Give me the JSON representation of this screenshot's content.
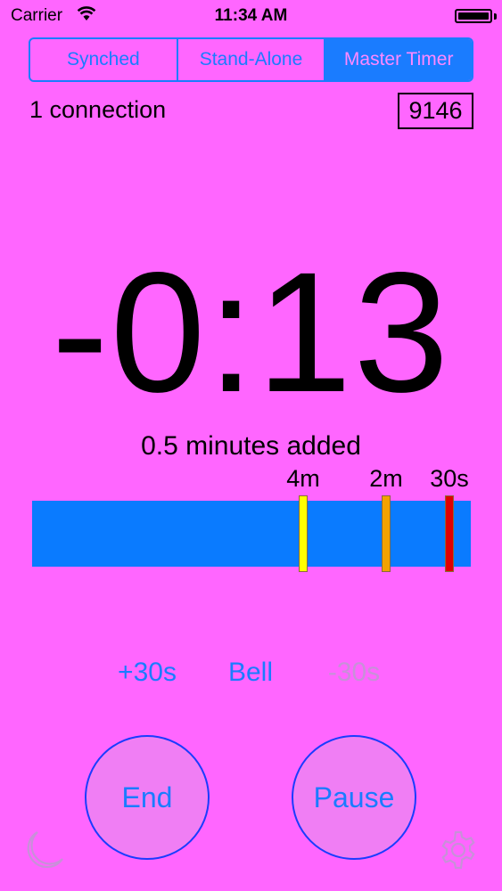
{
  "status_bar": {
    "carrier": "Carrier",
    "time": "11:34 AM"
  },
  "mode_control": {
    "segments": [
      "Synched",
      "Stand-Alone",
      "Master Timer"
    ],
    "selected": "Master Timer"
  },
  "connection_status": "1 connection",
  "session_code": "9146",
  "timer_display": "-0:13",
  "added_message": "0.5 minutes added",
  "progress": {
    "markers": [
      {
        "label": "4m",
        "color": "#ffff00"
      },
      {
        "label": "2m",
        "color": "#f2a200"
      },
      {
        "label": "30s",
        "color": "#e00000"
      }
    ],
    "bar_color": "#0a7bff"
  },
  "adjust_controls": {
    "plus": "+30s",
    "bell": "Bell",
    "minus": "-30s",
    "minus_enabled": false
  },
  "buttons": {
    "end": "End",
    "pause": "Pause"
  },
  "icons": {
    "night_mode": "moon-icon",
    "settings": "gear-icon"
  },
  "colors": {
    "background": "#ff66ff",
    "accent": "#1a7cff",
    "disabled": "#c890d8"
  }
}
